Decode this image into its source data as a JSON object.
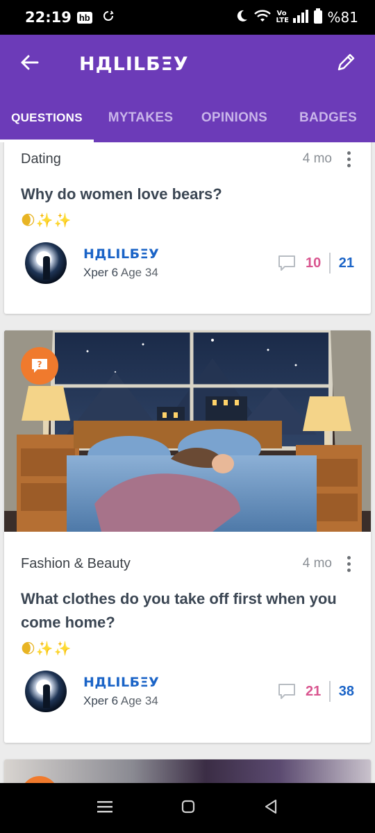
{
  "status_bar": {
    "time": "22:19",
    "notification_badge": "hb",
    "network_label": "Vo LTE",
    "battery": "%81"
  },
  "app_bar": {
    "title": "НДLILБΞУ"
  },
  "tabs": [
    {
      "label": "QUESTIONS",
      "active": true
    },
    {
      "label": "MYTAKES",
      "active": false
    },
    {
      "label": "OPINIONS",
      "active": false
    },
    {
      "label": "BADGES",
      "active": false
    }
  ],
  "cards": [
    {
      "topic": "Dating",
      "time_ago": "4 mo",
      "title": "Why do women love bears?",
      "emoji": "🌒✨✨",
      "author": {
        "name": "НДLILБΞУ",
        "xper": "Xper 6",
        "age": "Age 34"
      },
      "comments": "10",
      "opinions": "21"
    },
    {
      "topic": "Fashion & Beauty",
      "time_ago": "4 mo",
      "title": "What clothes do you take off first when you come home?",
      "emoji": "🌒✨✨",
      "author": {
        "name": "НДLILБΞУ",
        "xper": "Xper 6",
        "age": "Age 34"
      },
      "comments": "21",
      "opinions": "38",
      "badge_icon": "question-badge-icon",
      "image_icon": "sleeping-woman-bedroom-illustration"
    }
  ],
  "colors": {
    "primary": "#6c3bb8",
    "accent_orange": "#f07a2d",
    "comment_pink": "#d9558f",
    "opinion_blue": "#1b64c7"
  }
}
